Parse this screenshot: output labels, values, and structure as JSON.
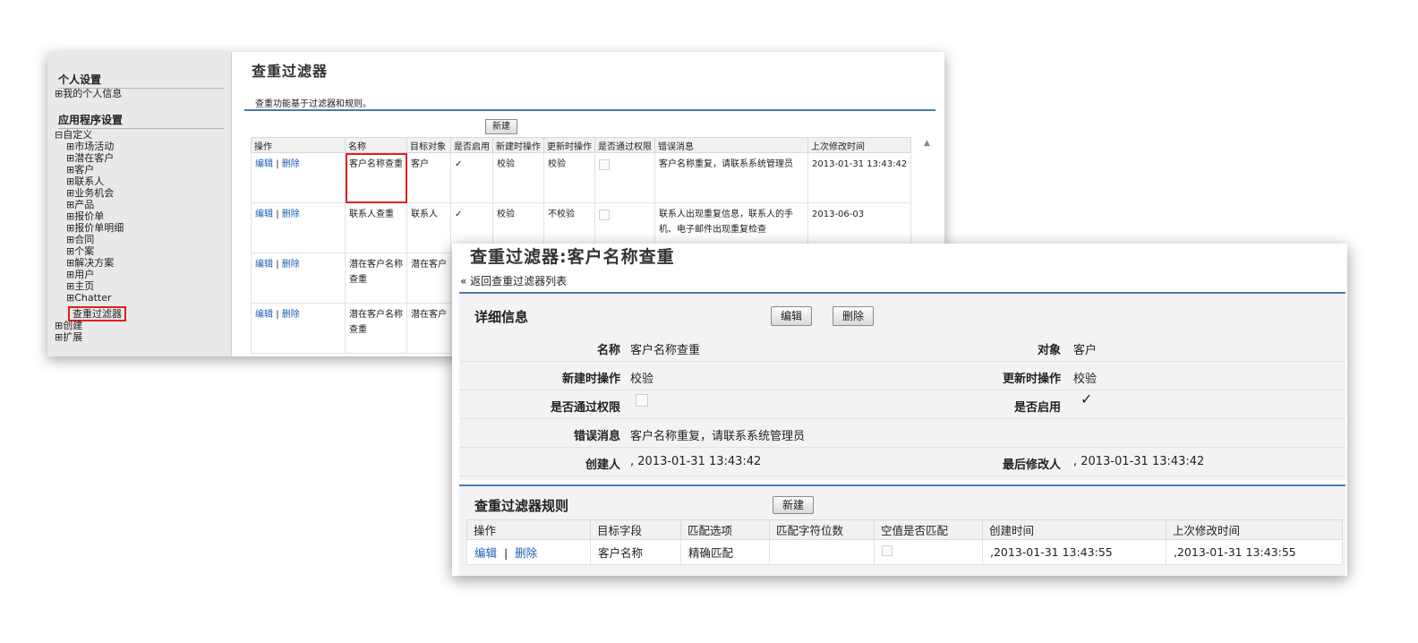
{
  "back_window": {
    "sidebar": {
      "personal_heading": "个人设置",
      "personal_items": [
        "⊞我的个人信息"
      ],
      "app_heading": "应用程序设置",
      "customize_label": "⊟自定义",
      "customize_items": [
        "⊞市场活动",
        "⊞潜在客户",
        "⊞客户",
        "⊞联系人",
        "⊞业务机会",
        "⊞产品",
        "⊞报价单",
        "⊞报价单明细",
        "⊞合同",
        "⊞个案",
        "⊞解决方案",
        "⊞用户",
        "⊞主页",
        "⊞Chatter"
      ],
      "selected_item": "查重过滤器",
      "bottom_items": [
        "⊞创建",
        "⊞扩展"
      ]
    },
    "title": "查重过滤器",
    "description": "查重功能基于过滤器和规则。",
    "new_button": "新建",
    "columns": [
      "操作",
      "名称",
      "目标对象",
      "是否启用",
      "新建时操作",
      "更新时操作",
      "是否通过权限",
      "错误消息",
      "上次修改时间"
    ],
    "rows": [
      {
        "edit": "编辑",
        "sep": "|",
        "del": "删除",
        "name": "客户名称查重",
        "object": "客户",
        "enabled": "✓",
        "on_create": "校验",
        "on_update": "校验",
        "error": "客户名称重复，请联系系统管理员",
        "modified": "2013-01-31 13:43:42"
      },
      {
        "edit": "编辑",
        "sep": "|",
        "del": "删除",
        "name": "联系人查重",
        "object": "联系人",
        "enabled": "✓",
        "on_create": "校验",
        "on_update": "不校验",
        "error": "联系人出现重复信息，联系人的手机、电子邮件出现重复检查",
        "modified": "2013-06-03"
      },
      {
        "edit": "编辑",
        "sep": "|",
        "del": "删除",
        "name": "潜在客户名称查重",
        "object": "潜在客户",
        "enabled": "",
        "on_create": "",
        "on_update": "",
        "error": "",
        "modified": ""
      },
      {
        "edit": "编辑",
        "sep": "|",
        "del": "删除",
        "name": "潜在客户名称查重",
        "object": "潜在客户",
        "enabled": "",
        "on_create": "",
        "on_update": "",
        "error": "",
        "modified": ""
      }
    ]
  },
  "front_window": {
    "title": "查重过滤器:客户名称查重",
    "back_link": "« 返回查重过滤器列表",
    "detail": {
      "heading": "详细信息",
      "edit_button": "编辑",
      "delete_button": "删除",
      "name_label": "名称",
      "name_value": "客户名称查重",
      "object_label": "对象",
      "object_value": "客户",
      "on_create_label": "新建时操作",
      "on_create_value": "校验",
      "on_update_label": "更新时操作",
      "on_update_value": "校验",
      "bypass_label": "是否通过权限",
      "enabled_label": "是否启用",
      "enabled_mark": "✓",
      "error_label": "错误消息",
      "error_value": "客户名称重复，请联系系统管理员",
      "created_by_label": "创建人",
      "created_by_value": ", 2013-01-31 13:43:42",
      "modified_by_label": "最后修改人",
      "modified_by_value": ", 2013-01-31 13:43:42"
    },
    "rules": {
      "heading": "查重过滤器规则",
      "new_button": "新建",
      "columns": [
        "操作",
        "目标字段",
        "匹配选项",
        "匹配字符位数",
        "空值是否匹配",
        "创建时间",
        "上次修改时间"
      ],
      "row": {
        "edit": "编辑",
        "sep": "|",
        "del": "删除",
        "field": "客户名称",
        "match": "精确匹配",
        "digits": "",
        "created": ",2013-01-31 13:43:55",
        "modified": ",2013-01-31 13:43:55"
      }
    }
  }
}
